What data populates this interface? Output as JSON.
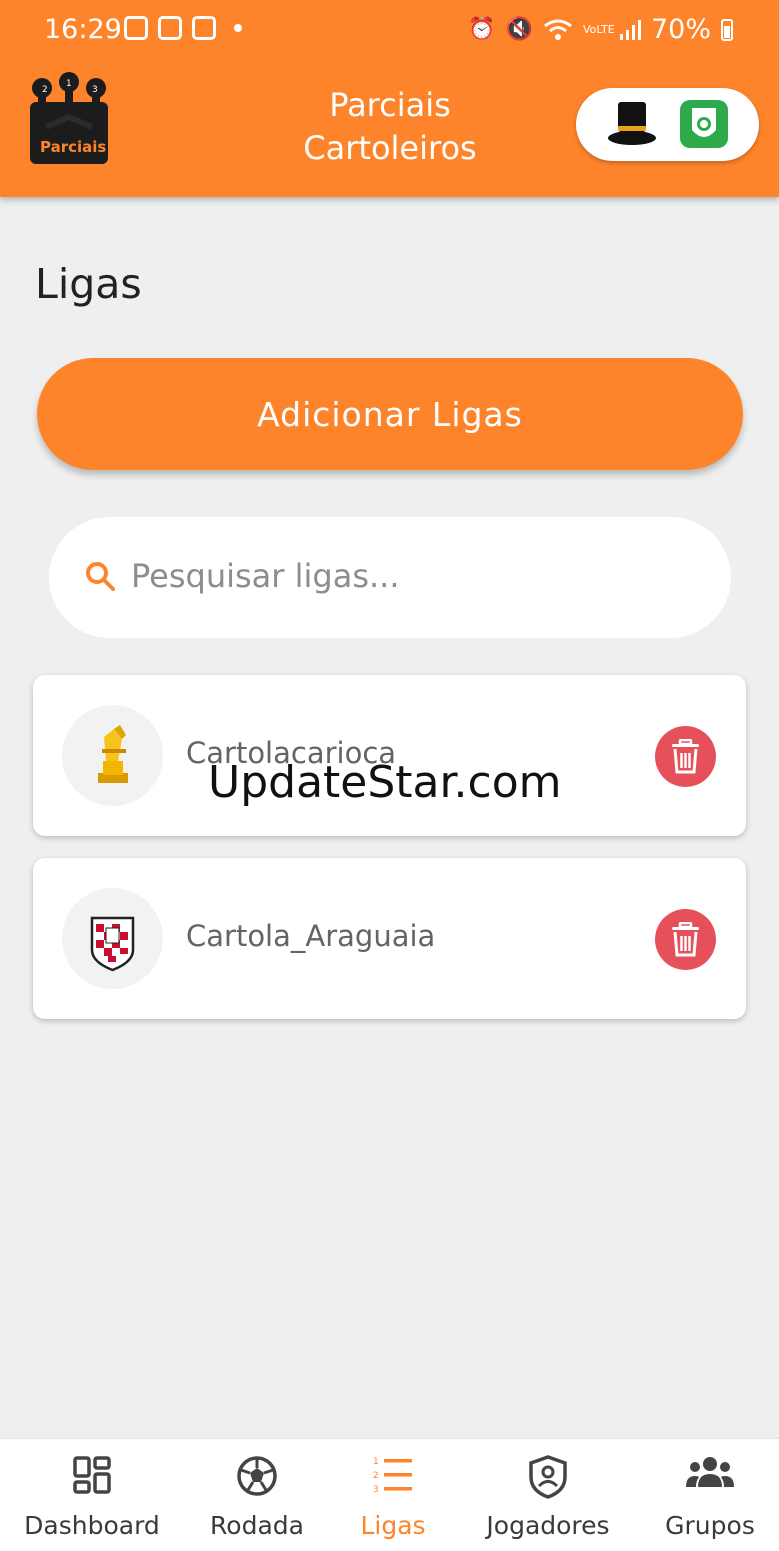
{
  "status_bar": {
    "time": "16:29",
    "battery": "70%",
    "network_label": "VoLTE"
  },
  "header": {
    "title_line1": "Parciais",
    "title_line2": "Cartoleiros",
    "logo_text": "Parciais",
    "podium_numbers": [
      "2",
      "1",
      "3"
    ]
  },
  "page": {
    "title": "Ligas",
    "add_button_label": "Adicionar Ligas"
  },
  "search": {
    "placeholder": "Pesquisar ligas..."
  },
  "leagues": [
    {
      "name": "Cartolacarioca",
      "logo_icon": "golden-trophy-icon"
    },
    {
      "name": "Cartola_Araguaia",
      "logo_icon": "checkered-shield-icon"
    }
  ],
  "watermark": "UpdateStar.com",
  "bottom_nav": [
    {
      "label": "Dashboard",
      "icon": "dashboard-icon",
      "active": false
    },
    {
      "label": "Rodada",
      "icon": "soccer-ball-icon",
      "active": false
    },
    {
      "label": "Ligas",
      "icon": "list-icon",
      "active": true
    },
    {
      "label": "Jogadores",
      "icon": "player-shield-icon",
      "active": false
    },
    {
      "label": "Grupos",
      "icon": "groups-icon",
      "active": false
    }
  ],
  "colors": {
    "brand_orange": "#fe842c",
    "delete_red": "#e5505a",
    "background": "#efefef"
  }
}
